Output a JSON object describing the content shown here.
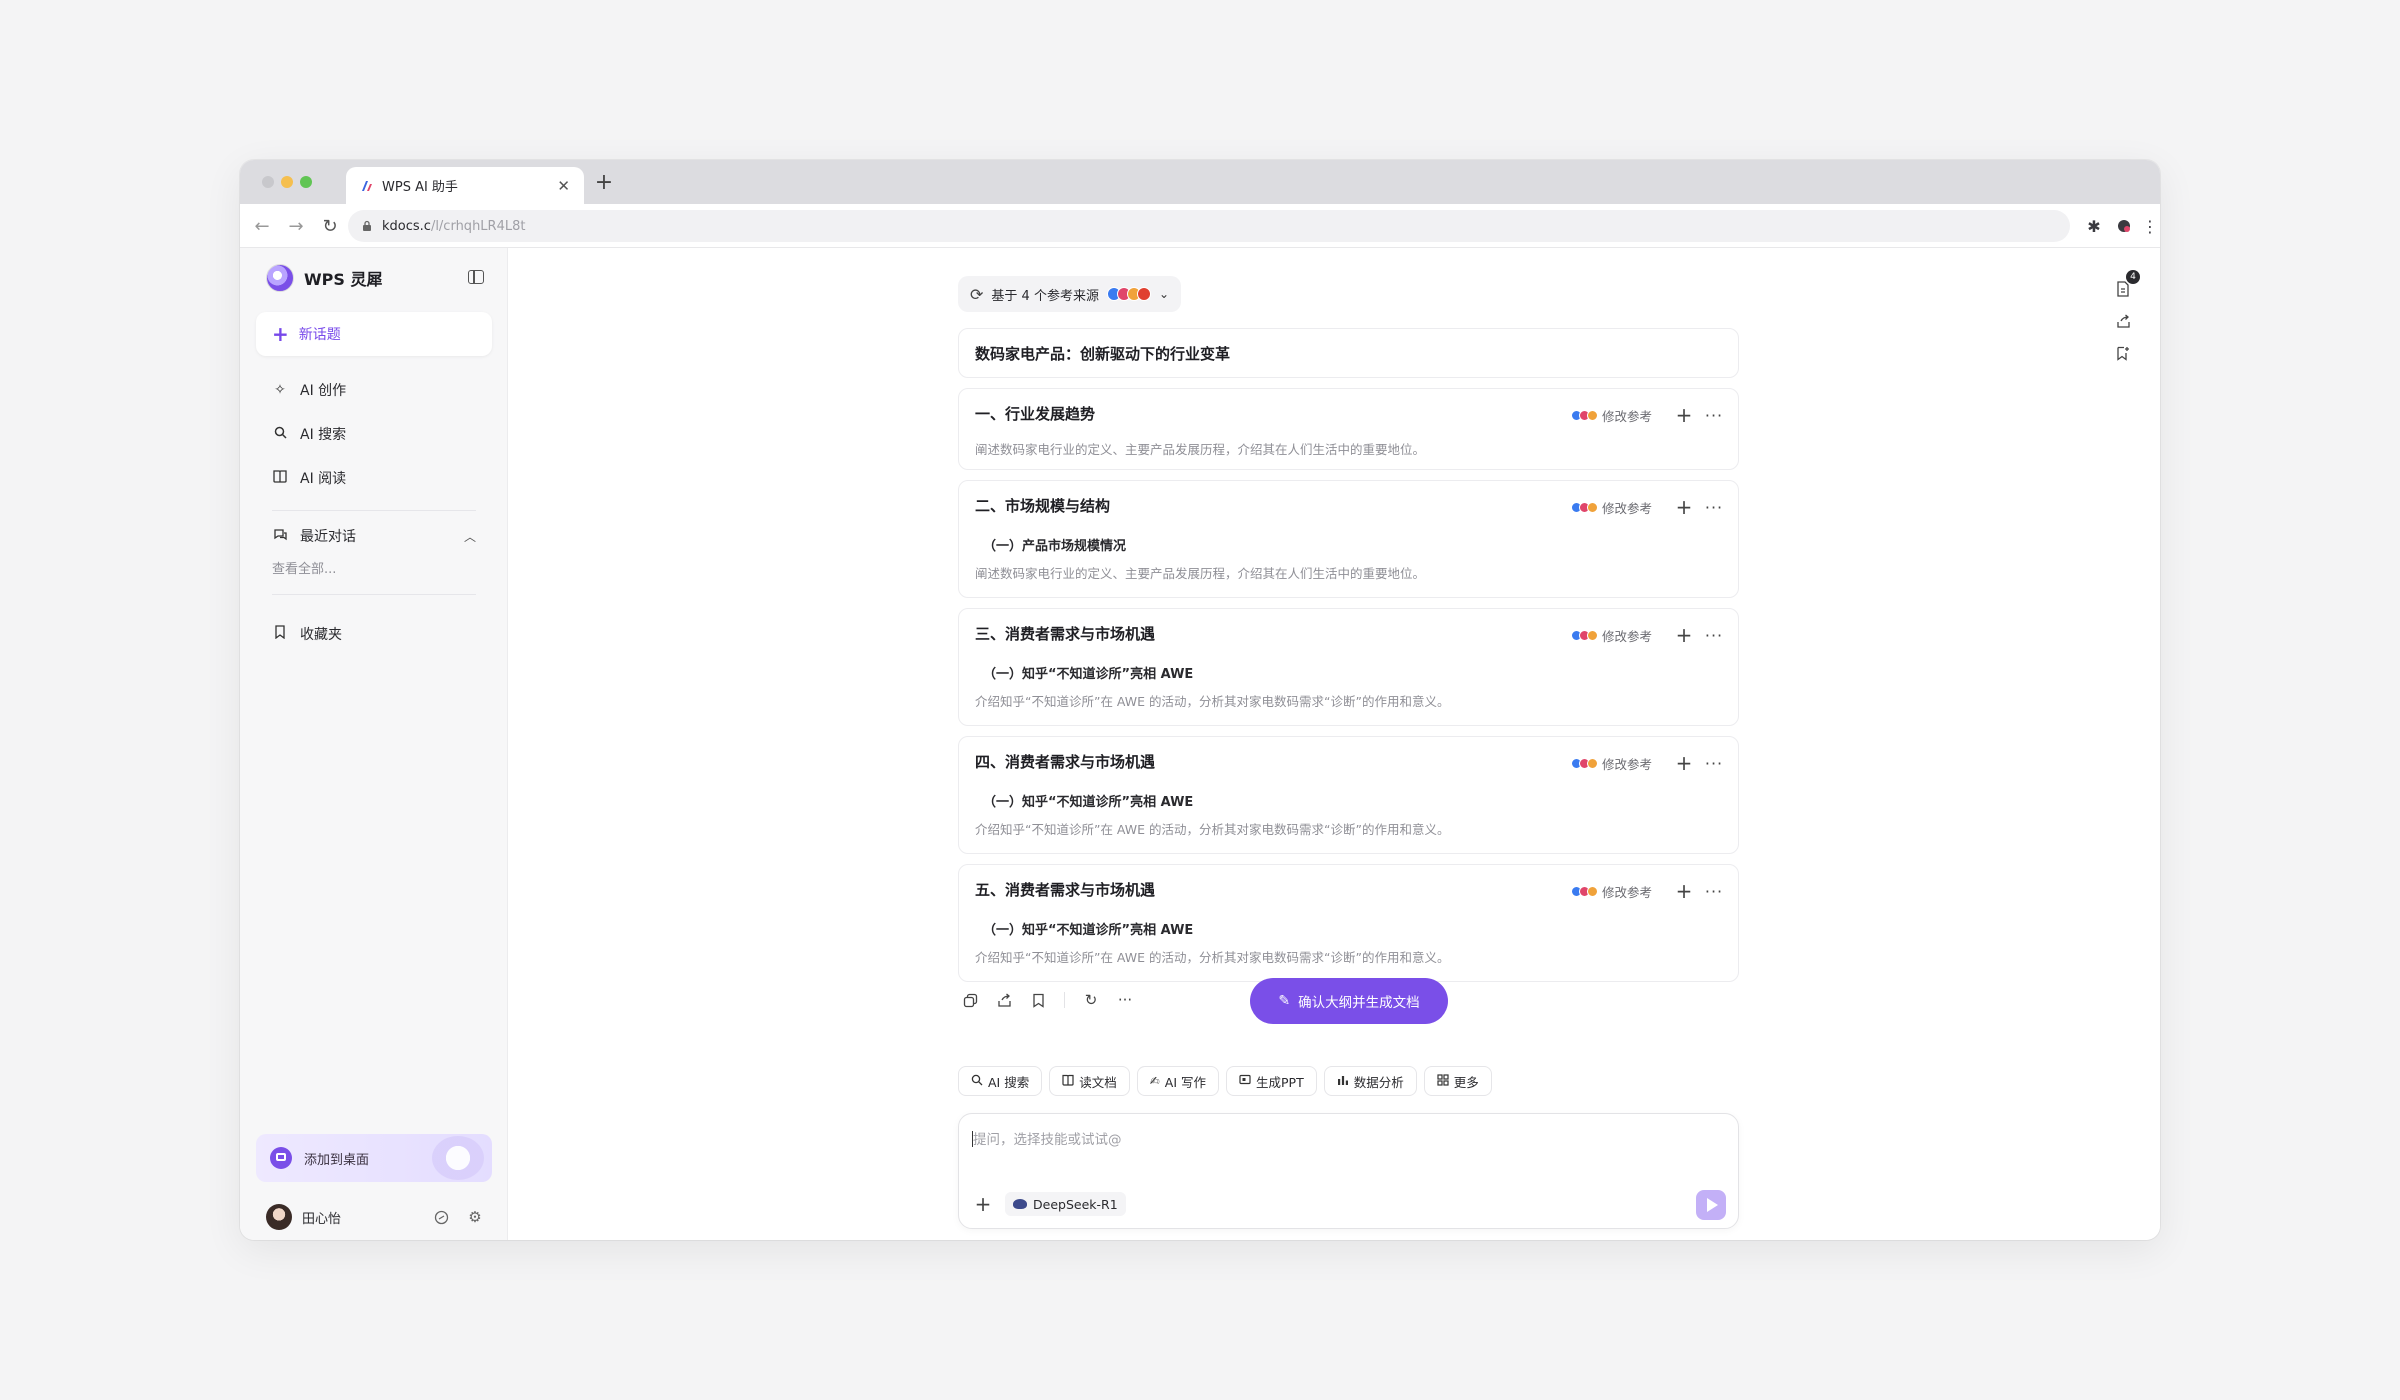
{
  "browser": {
    "tab_title": "WPS AI 助手",
    "url_domain": "kdocs.c",
    "url_path": "/l/crhqhLR4L8t"
  },
  "sidebar": {
    "brand_name": "WPS 灵犀",
    "new_topic": "新话题",
    "items": [
      {
        "label": "AI 创作"
      },
      {
        "label": "AI 搜索"
      },
      {
        "label": "AI 阅读"
      }
    ],
    "recent_label": "最近对话",
    "view_all": "查看全部...",
    "favorites": "收藏夹",
    "add_to_desktop": "添加到桌面",
    "user_name": "田心怡"
  },
  "main": {
    "source_pill": "基于 4 个参考来源",
    "doc_title": "数码家电产品：创新驱动下的行业变革",
    "modify_ref": "修改参考",
    "sections": [
      {
        "heading": "一、行业发展趋势",
        "sub": "",
        "desc": "阐述数码家电行业的定义、主要产品发展历程，介绍其在人们生活中的重要地位。"
      },
      {
        "heading": "二、市场规模与结构",
        "sub": "（一）产品市场规模情况",
        "desc": "阐述数码家电行业的定义、主要产品发展历程，介绍其在人们生活中的重要地位。"
      },
      {
        "heading": "三、消费者需求与市场机遇",
        "sub": "（一）知乎“不知道诊所”亮相 AWE",
        "desc": "介绍知乎“不知道诊所”在 AWE 的活动，分析其对家电数码需求“诊断”的作用和意义。"
      },
      {
        "heading": "四、消费者需求与市场机遇",
        "sub": "（一）知乎“不知道诊所”亮相 AWE",
        "desc": "介绍知乎“不知道诊所”在 AWE 的活动，分析其对家电数码需求“诊断”的作用和意义。"
      },
      {
        "heading": "五、消费者需求与市场机遇",
        "sub": "（一）知乎“不知道诊所”亮相 AWE",
        "desc": "介绍知乎“不知道诊所”在 AWE 的活动，分析其对家电数码需求“诊断”的作用和意义。"
      }
    ],
    "confirm_button": "确认大纲并生成文档",
    "chips": [
      {
        "label": "AI 搜索"
      },
      {
        "label": "读文档"
      },
      {
        "label": "AI 写作"
      },
      {
        "label": "生成PPT"
      },
      {
        "label": "数据分析"
      },
      {
        "label": "更多"
      }
    ],
    "input_placeholder": "提问，选择技能或试试@",
    "model_name": "DeepSeek-R1",
    "badge_count": "4"
  },
  "colors": {
    "accent": "#7a4fe8",
    "send_disabled": "#c3b0f7"
  }
}
